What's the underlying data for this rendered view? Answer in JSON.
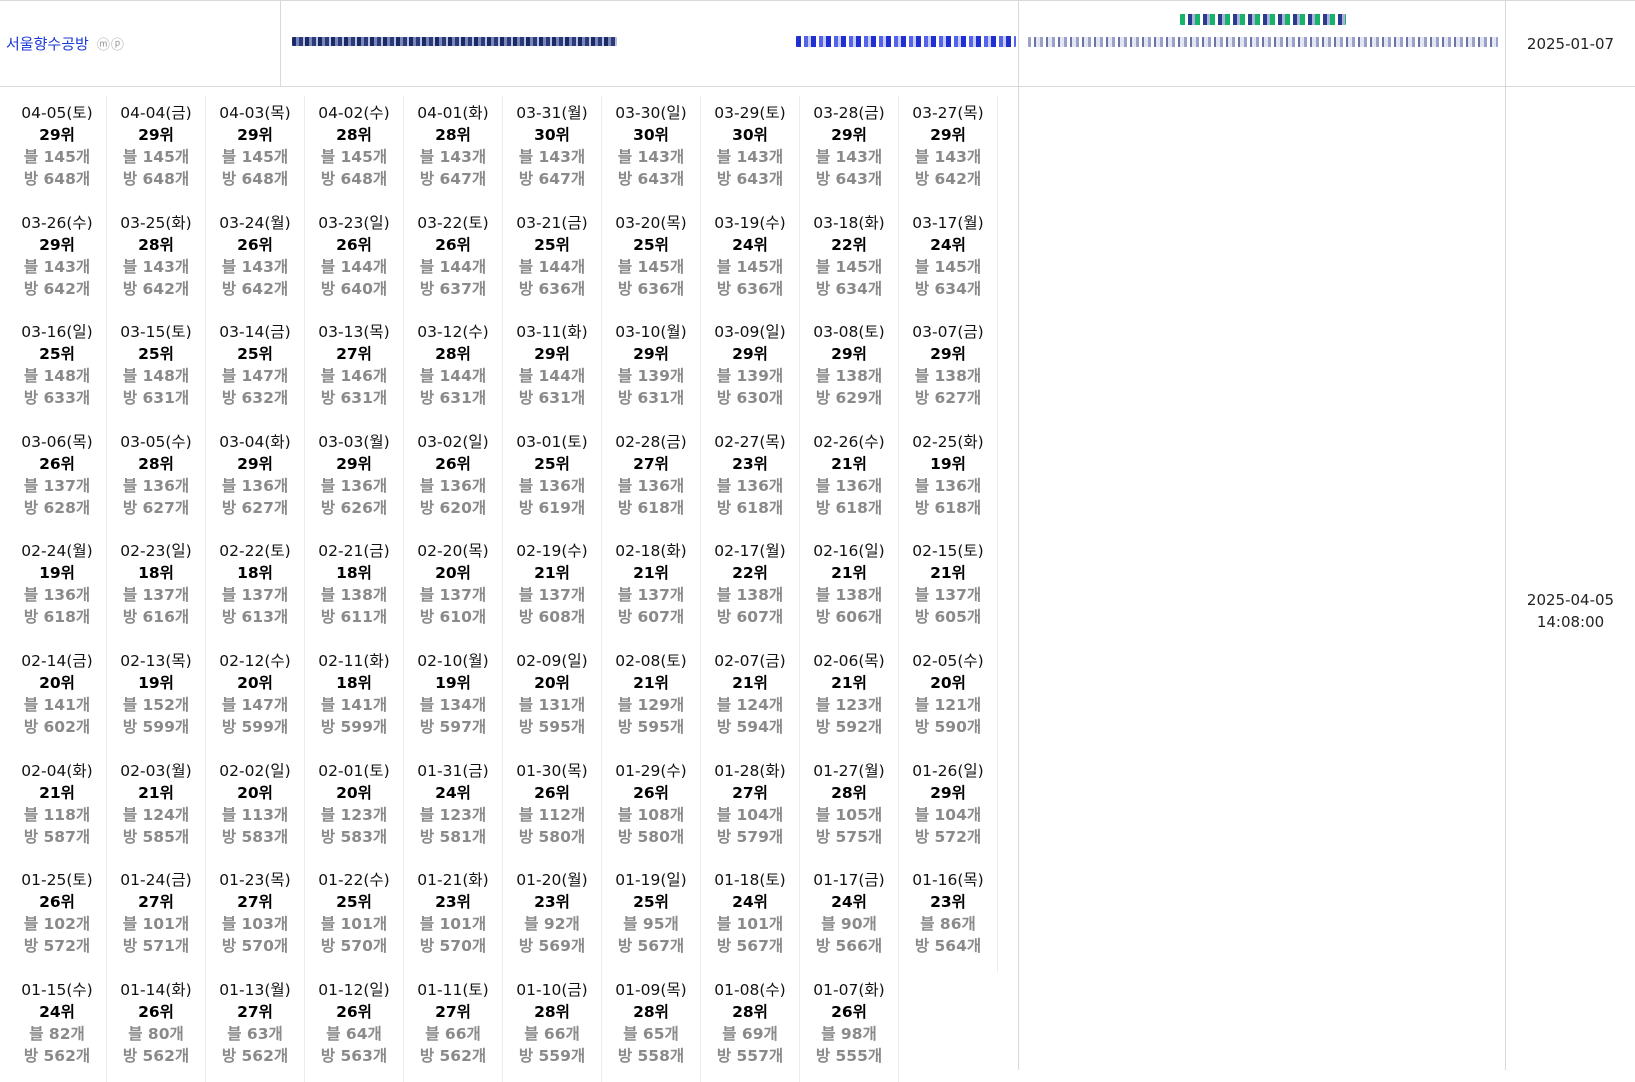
{
  "header": {
    "blog_title": "서울향수공방",
    "badges": "ⓜⓟ",
    "start_date": "2025-01-07"
  },
  "record": {
    "date": "2025-04-05",
    "time": "14:08:00"
  },
  "labels": {
    "rank_suffix": "위",
    "blog_prefix": "블 ",
    "room_prefix": "방 ",
    "count_suffix": "개"
  },
  "colors": {
    "title_link": "#1a3ad6",
    "border": "#d9d9d9",
    "muted": "#8a8a8a"
  },
  "days": [
    {
      "date": "04-05(토)",
      "rank": 29,
      "blog": 145,
      "room": 648
    },
    {
      "date": "04-04(금)",
      "rank": 29,
      "blog": 145,
      "room": 648
    },
    {
      "date": "04-03(목)",
      "rank": 29,
      "blog": 145,
      "room": 648
    },
    {
      "date": "04-02(수)",
      "rank": 28,
      "blog": 145,
      "room": 648
    },
    {
      "date": "04-01(화)",
      "rank": 28,
      "blog": 143,
      "room": 647
    },
    {
      "date": "03-31(월)",
      "rank": 30,
      "blog": 143,
      "room": 647
    },
    {
      "date": "03-30(일)",
      "rank": 30,
      "blog": 143,
      "room": 643
    },
    {
      "date": "03-29(토)",
      "rank": 30,
      "blog": 143,
      "room": 643
    },
    {
      "date": "03-28(금)",
      "rank": 29,
      "blog": 143,
      "room": 643
    },
    {
      "date": "03-27(목)",
      "rank": 29,
      "blog": 143,
      "room": 642
    },
    {
      "date": "03-26(수)",
      "rank": 29,
      "blog": 143,
      "room": 642
    },
    {
      "date": "03-25(화)",
      "rank": 28,
      "blog": 143,
      "room": 642
    },
    {
      "date": "03-24(월)",
      "rank": 26,
      "blog": 143,
      "room": 642
    },
    {
      "date": "03-23(일)",
      "rank": 26,
      "blog": 144,
      "room": 640
    },
    {
      "date": "03-22(토)",
      "rank": 26,
      "blog": 144,
      "room": 637
    },
    {
      "date": "03-21(금)",
      "rank": 25,
      "blog": 144,
      "room": 636
    },
    {
      "date": "03-20(목)",
      "rank": 25,
      "blog": 145,
      "room": 636
    },
    {
      "date": "03-19(수)",
      "rank": 24,
      "blog": 145,
      "room": 636
    },
    {
      "date": "03-18(화)",
      "rank": 22,
      "blog": 145,
      "room": 634
    },
    {
      "date": "03-17(월)",
      "rank": 24,
      "blog": 145,
      "room": 634
    },
    {
      "date": "03-16(일)",
      "rank": 25,
      "blog": 148,
      "room": 633
    },
    {
      "date": "03-15(토)",
      "rank": 25,
      "blog": 148,
      "room": 631
    },
    {
      "date": "03-14(금)",
      "rank": 25,
      "blog": 147,
      "room": 632
    },
    {
      "date": "03-13(목)",
      "rank": 27,
      "blog": 146,
      "room": 631
    },
    {
      "date": "03-12(수)",
      "rank": 28,
      "blog": 144,
      "room": 631
    },
    {
      "date": "03-11(화)",
      "rank": 29,
      "blog": 144,
      "room": 631
    },
    {
      "date": "03-10(월)",
      "rank": 29,
      "blog": 139,
      "room": 631
    },
    {
      "date": "03-09(일)",
      "rank": 29,
      "blog": 139,
      "room": 630
    },
    {
      "date": "03-08(토)",
      "rank": 29,
      "blog": 138,
      "room": 629
    },
    {
      "date": "03-07(금)",
      "rank": 29,
      "blog": 138,
      "room": 627
    },
    {
      "date": "03-06(목)",
      "rank": 26,
      "blog": 137,
      "room": 628
    },
    {
      "date": "03-05(수)",
      "rank": 28,
      "blog": 136,
      "room": 627
    },
    {
      "date": "03-04(화)",
      "rank": 29,
      "blog": 136,
      "room": 627
    },
    {
      "date": "03-03(월)",
      "rank": 29,
      "blog": 136,
      "room": 626
    },
    {
      "date": "03-02(일)",
      "rank": 26,
      "blog": 136,
      "room": 620
    },
    {
      "date": "03-01(토)",
      "rank": 25,
      "blog": 136,
      "room": 619
    },
    {
      "date": "02-28(금)",
      "rank": 27,
      "blog": 136,
      "room": 618
    },
    {
      "date": "02-27(목)",
      "rank": 23,
      "blog": 136,
      "room": 618
    },
    {
      "date": "02-26(수)",
      "rank": 21,
      "blog": 136,
      "room": 618
    },
    {
      "date": "02-25(화)",
      "rank": 19,
      "blog": 136,
      "room": 618
    },
    {
      "date": "02-24(월)",
      "rank": 19,
      "blog": 136,
      "room": 618
    },
    {
      "date": "02-23(일)",
      "rank": 18,
      "blog": 137,
      "room": 616
    },
    {
      "date": "02-22(토)",
      "rank": 18,
      "blog": 137,
      "room": 613
    },
    {
      "date": "02-21(금)",
      "rank": 18,
      "blog": 138,
      "room": 611
    },
    {
      "date": "02-20(목)",
      "rank": 20,
      "blog": 137,
      "room": 610
    },
    {
      "date": "02-19(수)",
      "rank": 21,
      "blog": 137,
      "room": 608
    },
    {
      "date": "02-18(화)",
      "rank": 21,
      "blog": 137,
      "room": 607
    },
    {
      "date": "02-17(월)",
      "rank": 22,
      "blog": 138,
      "room": 607
    },
    {
      "date": "02-16(일)",
      "rank": 21,
      "blog": 138,
      "room": 606
    },
    {
      "date": "02-15(토)",
      "rank": 21,
      "blog": 137,
      "room": 605
    },
    {
      "date": "02-14(금)",
      "rank": 20,
      "blog": 141,
      "room": 602
    },
    {
      "date": "02-13(목)",
      "rank": 19,
      "blog": 152,
      "room": 599
    },
    {
      "date": "02-12(수)",
      "rank": 20,
      "blog": 147,
      "room": 599
    },
    {
      "date": "02-11(화)",
      "rank": 18,
      "blog": 141,
      "room": 599
    },
    {
      "date": "02-10(월)",
      "rank": 19,
      "blog": 134,
      "room": 597
    },
    {
      "date": "02-09(일)",
      "rank": 20,
      "blog": 131,
      "room": 595
    },
    {
      "date": "02-08(토)",
      "rank": 21,
      "blog": 129,
      "room": 595
    },
    {
      "date": "02-07(금)",
      "rank": 21,
      "blog": 124,
      "room": 594
    },
    {
      "date": "02-06(목)",
      "rank": 21,
      "blog": 123,
      "room": 592
    },
    {
      "date": "02-05(수)",
      "rank": 20,
      "blog": 121,
      "room": 590
    },
    {
      "date": "02-04(화)",
      "rank": 21,
      "blog": 118,
      "room": 587
    },
    {
      "date": "02-03(월)",
      "rank": 21,
      "blog": 124,
      "room": 585
    },
    {
      "date": "02-02(일)",
      "rank": 20,
      "blog": 113,
      "room": 583
    },
    {
      "date": "02-01(토)",
      "rank": 20,
      "blog": 123,
      "room": 583
    },
    {
      "date": "01-31(금)",
      "rank": 24,
      "blog": 123,
      "room": 581
    },
    {
      "date": "01-30(목)",
      "rank": 26,
      "blog": 112,
      "room": 580
    },
    {
      "date": "01-29(수)",
      "rank": 26,
      "blog": 108,
      "room": 580
    },
    {
      "date": "01-28(화)",
      "rank": 27,
      "blog": 104,
      "room": 579
    },
    {
      "date": "01-27(월)",
      "rank": 28,
      "blog": 105,
      "room": 575
    },
    {
      "date": "01-26(일)",
      "rank": 29,
      "blog": 104,
      "room": 572
    },
    {
      "date": "01-25(토)",
      "rank": 26,
      "blog": 102,
      "room": 572
    },
    {
      "date": "01-24(금)",
      "rank": 27,
      "blog": 101,
      "room": 571
    },
    {
      "date": "01-23(목)",
      "rank": 27,
      "blog": 103,
      "room": 570
    },
    {
      "date": "01-22(수)",
      "rank": 25,
      "blog": 101,
      "room": 570
    },
    {
      "date": "01-21(화)",
      "rank": 23,
      "blog": 101,
      "room": 570
    },
    {
      "date": "01-20(월)",
      "rank": 23,
      "blog": 92,
      "room": 569
    },
    {
      "date": "01-19(일)",
      "rank": 25,
      "blog": 95,
      "room": 567
    },
    {
      "date": "01-18(토)",
      "rank": 24,
      "blog": 101,
      "room": 567
    },
    {
      "date": "01-17(금)",
      "rank": 24,
      "blog": 90,
      "room": 566
    },
    {
      "date": "01-16(목)",
      "rank": 23,
      "blog": 86,
      "room": 564
    },
    {
      "date": "01-15(수)",
      "rank": 24,
      "blog": 82,
      "room": 562
    },
    {
      "date": "01-14(화)",
      "rank": 26,
      "blog": 80,
      "room": 562
    },
    {
      "date": "01-13(월)",
      "rank": 27,
      "blog": 63,
      "room": 562
    },
    {
      "date": "01-12(일)",
      "rank": 26,
      "blog": 64,
      "room": 563
    },
    {
      "date": "01-11(토)",
      "rank": 27,
      "blog": 66,
      "room": 562
    },
    {
      "date": "01-10(금)",
      "rank": 28,
      "blog": 66,
      "room": 559
    },
    {
      "date": "01-09(목)",
      "rank": 28,
      "blog": 65,
      "room": 558
    },
    {
      "date": "01-08(수)",
      "rank": 28,
      "blog": 69,
      "room": 557
    },
    {
      "date": "01-07(화)",
      "rank": 26,
      "blog": 98,
      "room": 555
    }
  ]
}
